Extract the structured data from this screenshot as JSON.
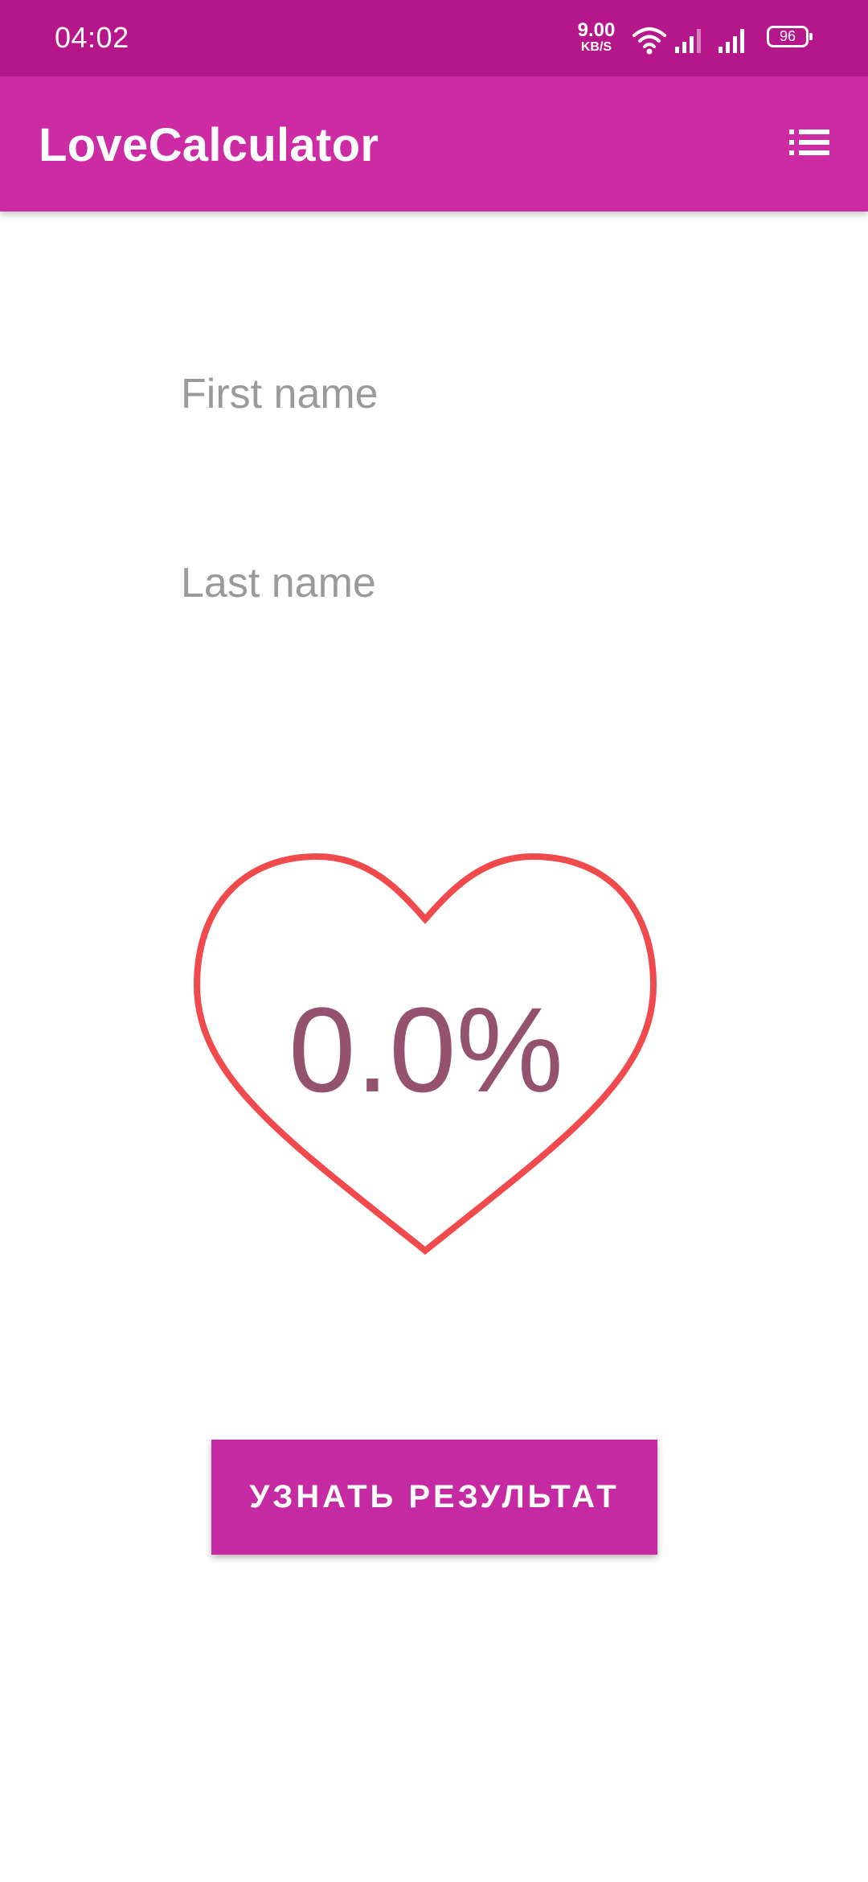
{
  "status_bar": {
    "time": "04:02",
    "speed_value": "9.00",
    "speed_unit": "KB/S",
    "battery": "96",
    "icons": [
      "wifi-icon",
      "signal-icon",
      "signal-icon",
      "battery-icon"
    ]
  },
  "app_bar": {
    "title": "LoveCalculator",
    "menu_icon": "list-icon"
  },
  "form": {
    "first_name_placeholder": "First name",
    "first_name_value": "",
    "last_name_placeholder": "Last name",
    "last_name_value": ""
  },
  "result": {
    "percentage": "0.0%"
  },
  "action": {
    "button_label": "УЗНАТЬ РЕЗУЛЬТАТ"
  },
  "colors": {
    "status_bar": "#b5168a",
    "app_bar": "#cc2ba4",
    "heart_stroke": "#f04a4c",
    "percentage_text": "#94526e",
    "button": "#c62aa2"
  }
}
